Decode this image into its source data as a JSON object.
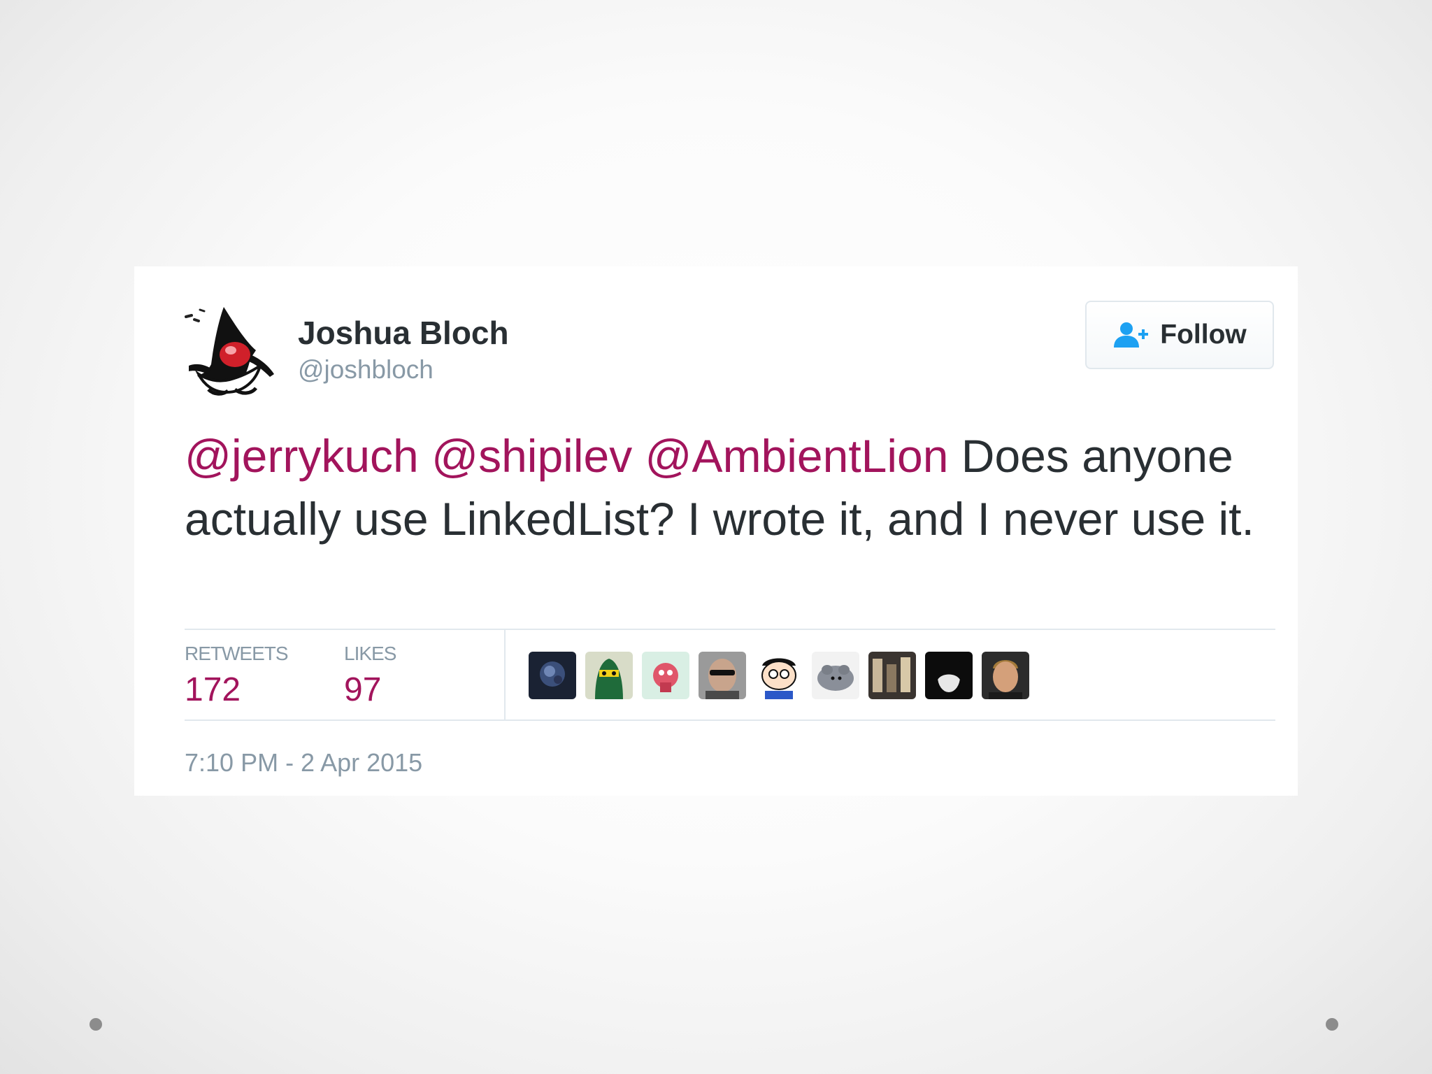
{
  "tweet": {
    "author": {
      "display_name": "Joshua Bloch",
      "handle": "@joshbloch",
      "avatar_icon": "duke-mascot-icon"
    },
    "follow_button": {
      "label": "Follow",
      "icon": "add-user-icon"
    },
    "text": {
      "mentions": [
        "@jerrykuch",
        "@shipilev",
        "@AmbientLion"
      ],
      "body": "Does anyone actually use LinkedList?  I wrote it, and I never use it."
    },
    "stats": {
      "retweets_label": "RETWEETS",
      "retweets_value": "172",
      "likes_label": "LIKES",
      "likes_value": "97"
    },
    "likers_count_shown": 9,
    "timestamp": "7:10 PM - 2 Apr 2015"
  },
  "colors": {
    "accent": "#a2145c",
    "text": "#292f33",
    "muted": "#8899a6",
    "follow_icon": "#1da1f2"
  }
}
